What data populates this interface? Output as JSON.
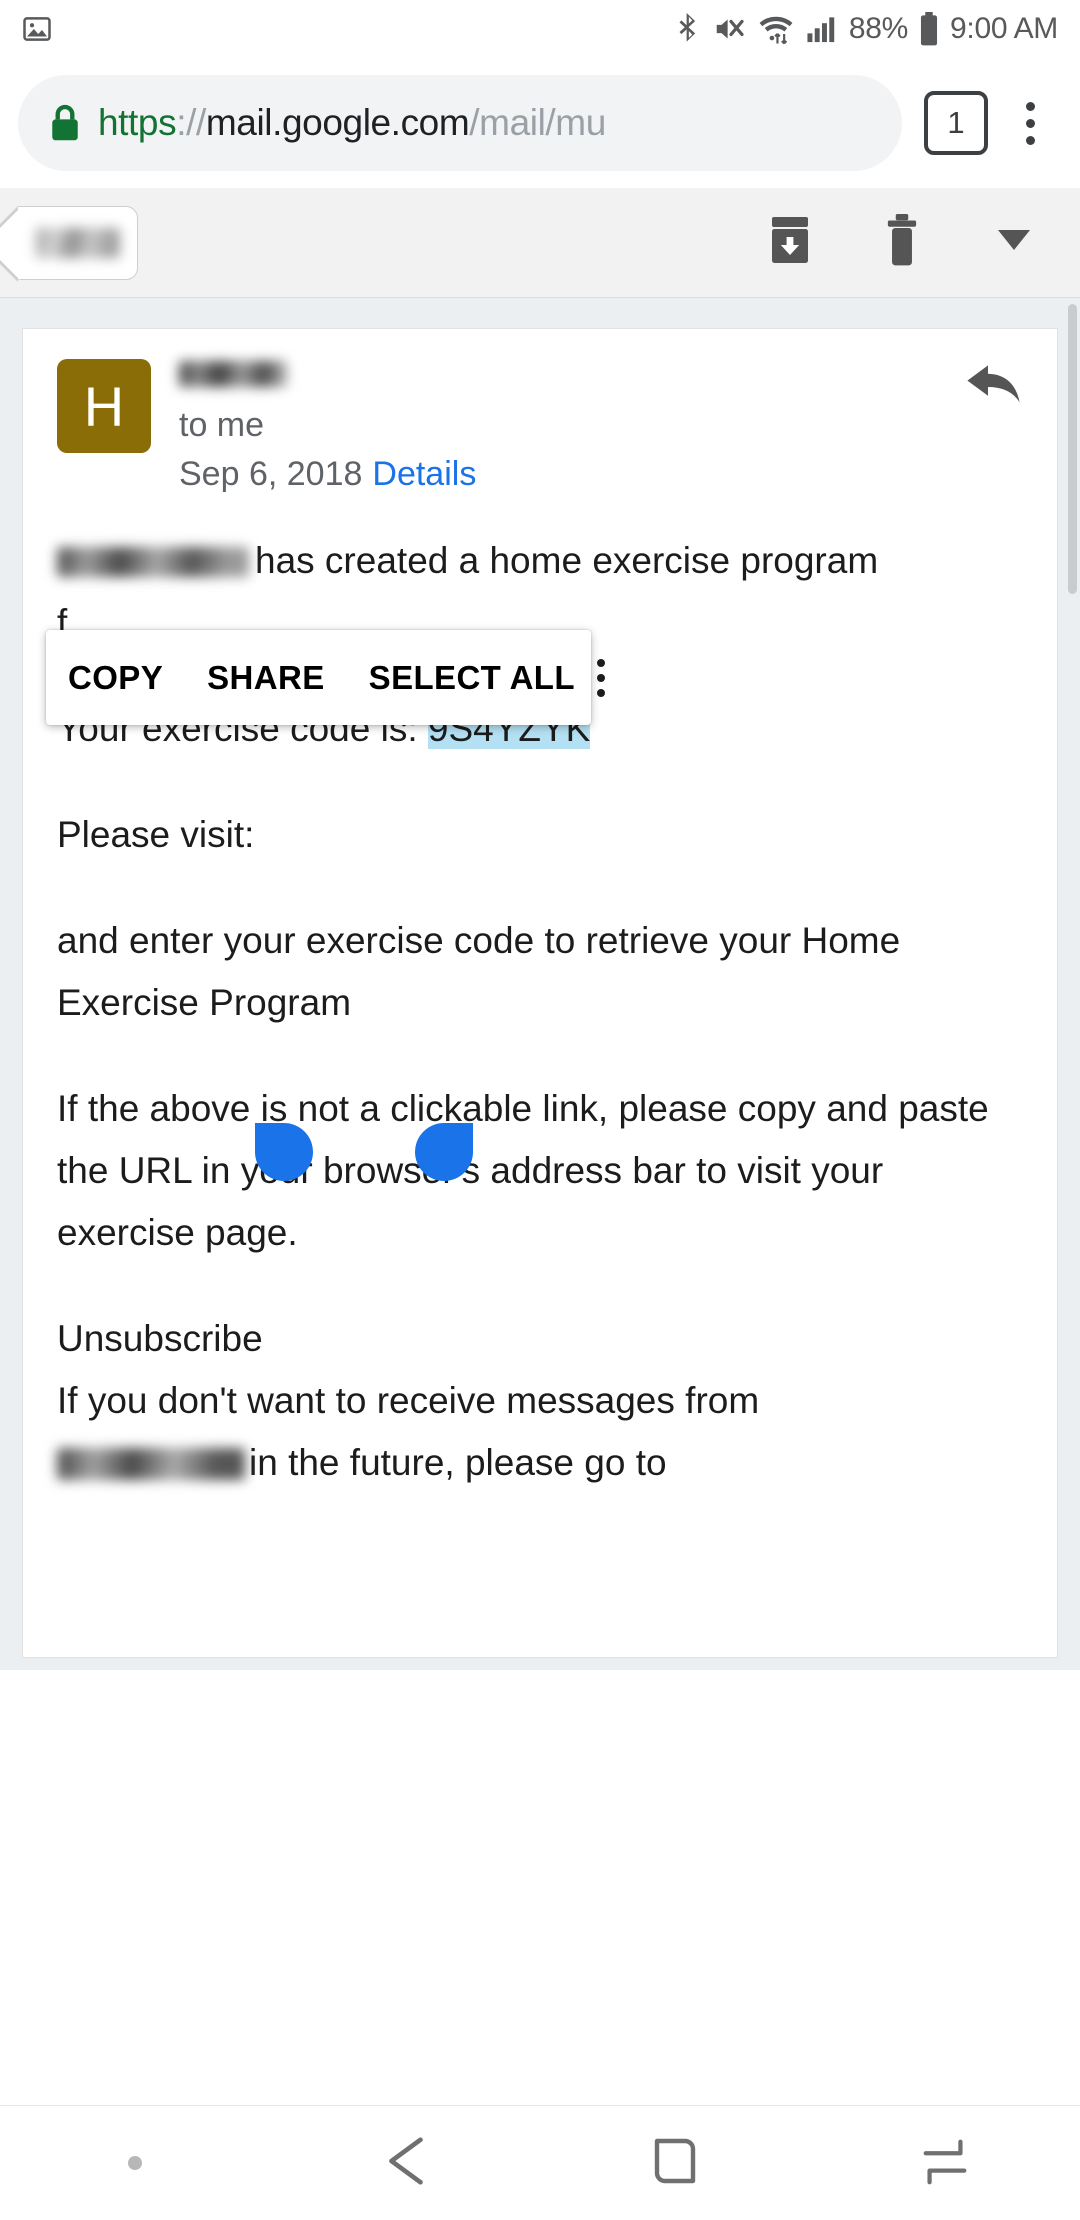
{
  "statusbar": {
    "icons": [
      "image-icon",
      "bluetooth-icon",
      "mute-icon",
      "wifi-icon",
      "signal-icon"
    ],
    "battery_percent": "88%",
    "time": "9:00 AM"
  },
  "browser": {
    "url_scheme": "https",
    "url_separator": "://",
    "url_host": "mail.google.com",
    "url_path": "/mail/mu",
    "tab_count": "1",
    "lock_color": "#137333",
    "scheme_color": "#137333"
  },
  "gmail_toolbar": {
    "back_label_redacted": "",
    "archive_icon": "archive-icon",
    "delete_icon": "trash-icon",
    "more_icon": "chevron-down-icon"
  },
  "message": {
    "avatar_letter": "H",
    "avatar_color": "#8a6d06",
    "sender_redacted": "",
    "recipient": "to me",
    "date": "Sep 6, 2018",
    "details_link": "Details",
    "details_link_color": "#1a73e8",
    "reply_icon": "reply-icon"
  },
  "body": {
    "line1_after_name": "has created a home exercise program",
    "line2_start": "f",
    "code_label": "Your exercise code is:",
    "code_value": "9S4YZYK",
    "code_highlight_color": "#b3e0f2",
    "please_visit": "Please visit:",
    "paragraph_enter_code": "and enter your exercise code to retrieve your Home Exercise Program",
    "paragraph_clickable": "If the above is not a clickable link, please copy and paste the URL in your browser's address bar to visit your exercise page.",
    "unsubscribe_heading": "Unsubscribe",
    "unsubscribe_text_before": "If you don't want to receive messages from",
    "unsubscribe_text_after": "in the future, please go to"
  },
  "context_menu": {
    "copy": "COPY",
    "share": "SHARE",
    "select_all": "SELECT ALL",
    "overflow_icon": "kebab-menu-icon"
  },
  "selection": {
    "handle_color": "#1a73e8",
    "left_handle": "selection-handle-left",
    "right_handle": "selection-handle-right"
  },
  "navbar": {
    "recents_icon": "recents-icon",
    "back_icon": "back-arrow-icon",
    "home_icon": "home-icon",
    "overview_icon": "overview-icon"
  }
}
